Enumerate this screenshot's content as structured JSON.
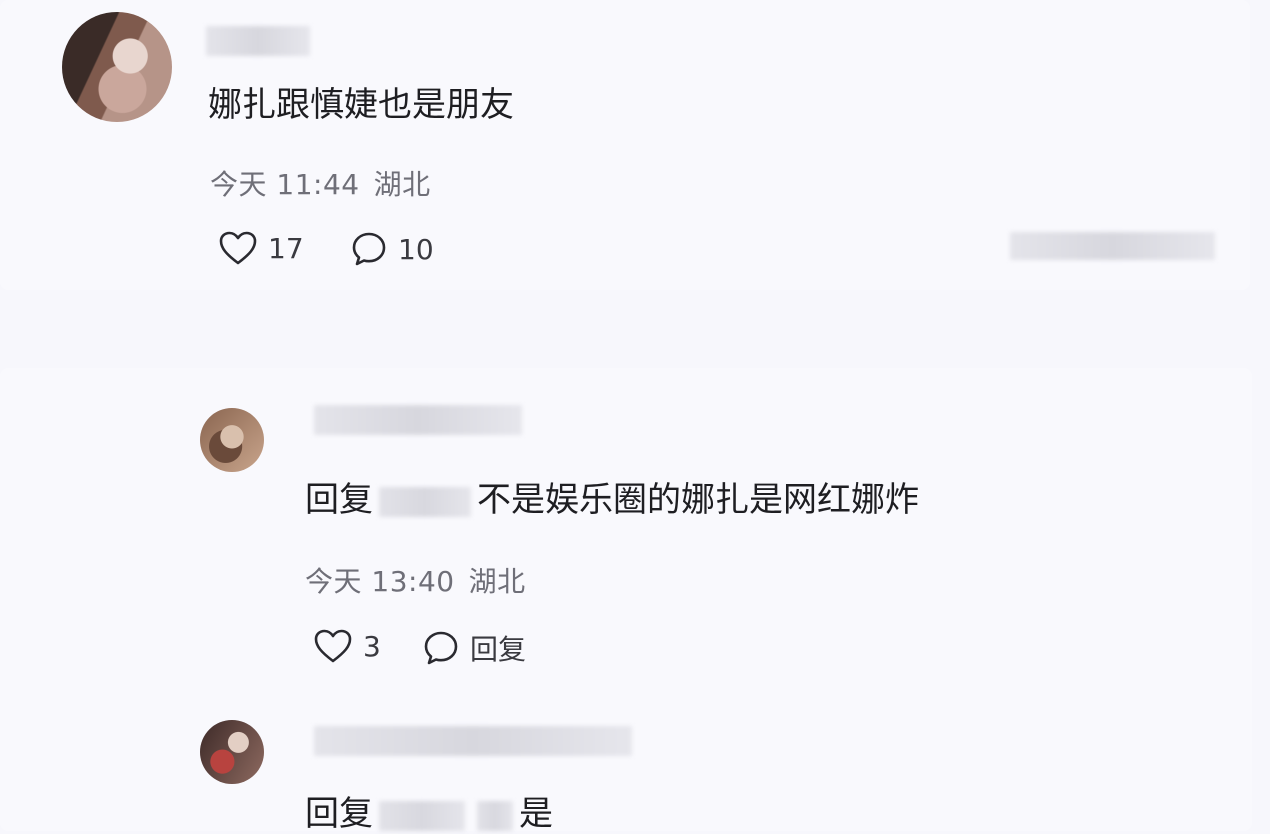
{
  "comment": {
    "text": "娜扎跟慎婕也是朋友",
    "time": "今天 11:44",
    "location": "湖北",
    "likes": "17",
    "replies": "10"
  },
  "reply1": {
    "prefix": "回复",
    "text": "不是娱乐圈的娜扎是网红娜炸",
    "time": "今天 13:40",
    "location": "湖北",
    "likes": "3",
    "reply_label": "回复"
  },
  "reply2": {
    "prefix": "回复",
    "text": "是"
  },
  "icons": {
    "like": "heart-outline-icon",
    "comment": "speech-bubble-icon"
  },
  "colors": {
    "background": "#f7f7fc",
    "text": "#1e1e22",
    "meta": "#6f6f78"
  }
}
